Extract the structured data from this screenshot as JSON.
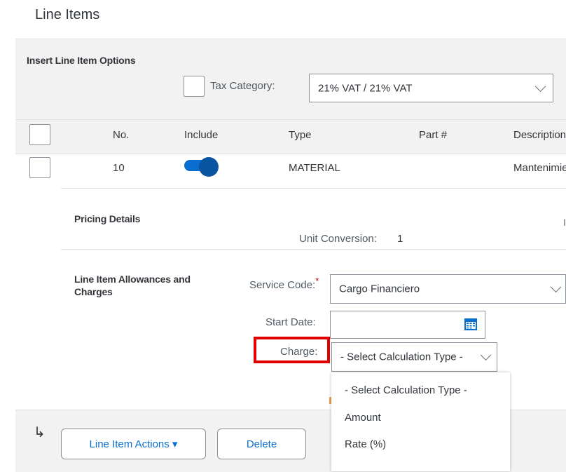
{
  "page_title": "Line Items",
  "insert_options": {
    "title": "Insert Line Item Options",
    "tax_category_label": "Tax Category:",
    "tax_category_value": "21% VAT / 21% VAT"
  },
  "table": {
    "headers": [
      "No.",
      "Include",
      "Type",
      "Part #",
      "Description"
    ],
    "row": {
      "no": "10",
      "include_on": true,
      "type": "MATERIAL",
      "description": "Mantenimie"
    }
  },
  "pricing": {
    "title": "Pricing Details",
    "unit_conversion_label": "Unit Conversion:",
    "unit_conversion_value": "1",
    "edge_text": "I"
  },
  "allowances": {
    "title": "Line Item Allowances and Charges",
    "service_code_label": "Service Code:",
    "required_mark": "*",
    "service_code_value": "Cargo Financiero",
    "start_date_label": "Start Date:",
    "start_date_value": "",
    "charge_label": "Charge:",
    "charge_value": "- Select Calculation Type -"
  },
  "dropdown_options": [
    "- Select Calculation Type -",
    "Amount",
    "Rate (%)"
  ],
  "footer": {
    "arrow_glyph": "↳",
    "line_item_actions_label": "Line Item Actions ▾",
    "delete_label": "Delete"
  },
  "colors": {
    "accent": "#0a6ed1",
    "highlight_box": "#e00000",
    "required": "#bb0000",
    "panel_bg": "#f2f2f2"
  },
  "icons": [
    "calendar-icon",
    "chevron-down-icon",
    "return-arrow-icon"
  ]
}
